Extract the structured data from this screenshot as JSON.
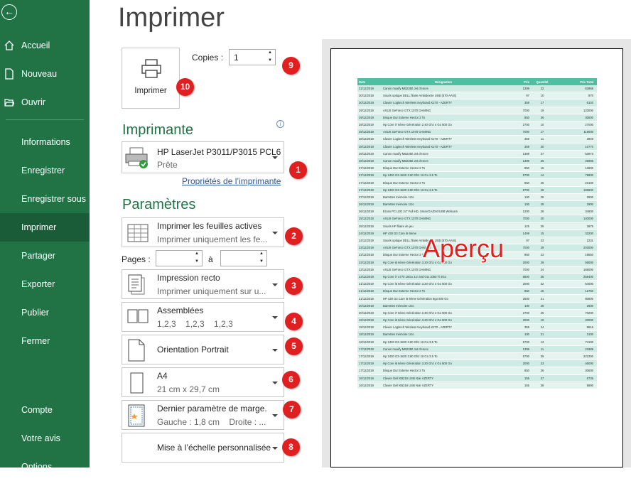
{
  "sidebar": {
    "back_icon": "back-arrow-icon",
    "items": [
      {
        "label": "Accueil",
        "icon": "home-icon"
      },
      {
        "label": "Nouveau",
        "icon": "new-document-icon"
      },
      {
        "label": "Ouvrir",
        "icon": "open-folder-icon"
      },
      {
        "label": "Informations"
      },
      {
        "label": "Enregistrer"
      },
      {
        "label": "Enregistrer sous"
      },
      {
        "label": "Imprimer",
        "selected": true
      },
      {
        "label": "Partager"
      },
      {
        "label": "Exporter"
      },
      {
        "label": "Publier"
      },
      {
        "label": "Fermer"
      },
      {
        "label": "Compte"
      },
      {
        "label": "Votre avis"
      },
      {
        "label": "Options"
      }
    ],
    "bg_color": "#217346",
    "selected_color": "#1a5c38"
  },
  "page_title": "Imprimer",
  "print_button": {
    "label": "Imprimer",
    "badge": "10"
  },
  "copies": {
    "label": "Copies :",
    "value": "1",
    "badge": "9"
  },
  "printer": {
    "section_title": "Imprimante",
    "info_icon": "info-icon",
    "name": "HP LaserJet P3011/P3015 PCL6",
    "status": "Prête",
    "badge": "1",
    "properties_link": "Propriétés de l’imprimante"
  },
  "settings": {
    "section_title": "Paramètres",
    "items": [
      {
        "line1": "Imprimer les feuilles actives",
        "line2": "Imprimer uniquement les fe...",
        "badge": "2",
        "icon": "sheets-grid-icon"
      },
      {
        "line1": "Impression recto",
        "line2": "Imprimer uniquement sur u...",
        "badge": "3",
        "icon": "one-sided-icon"
      },
      {
        "line1": "Assemblées",
        "line2": "1,2,3    1,2,3    1,2,3",
        "badge": "4",
        "icon": "collated-icon"
      },
      {
        "line1": "Orientation Portrait",
        "line2": "",
        "badge": "5",
        "icon": "portrait-icon"
      },
      {
        "line1": "A4",
        "line2": "21 cm x 29,7 cm",
        "badge": "6",
        "icon": "paper-size-icon"
      },
      {
        "line1": "Dernier paramètre de marge...",
        "line2": "Gauche : 1,8 cm    Droite : ...",
        "badge": "7",
        "icon": "margins-icon"
      },
      {
        "line1": "Mise à l’échelle personnalisée",
        "line2": "",
        "badge": "8",
        "icon": ""
      }
    ],
    "pages_label": "Pages :",
    "pages_to": "à",
    "pages_from_value": "",
    "pages_to_value": ""
  },
  "preview": {
    "overlay_label": "Aperçu",
    "table_header": [
      "Date",
      "Désignation",
      "Prix",
      "Quantité",
      "Prix Total"
    ],
    "rows": [
      [
        "31/12/2019",
        "Canon maxify MB2350 Jet d'encre",
        "1399",
        "22",
        "63968"
      ],
      [
        "30/12/2019",
        "Souris optique DELL filaire Ambidextre USB (570-AAIS)",
        "97",
        "10",
        "970"
      ],
      [
        "30/12/2019",
        "Clavier Logitech Wireless Keyboard K270 - AZERTY",
        "359",
        "17",
        "6103"
      ],
      [
        "29/12/2019",
        "ASUS GeForce GTX 1070 GAMING",
        "7000",
        "19",
        "133000"
      ],
      [
        "29/12/2019",
        "Disque Dur Externe Hector 2 To",
        "850",
        "36",
        "30600"
      ],
      [
        "28/12/2019",
        "Hp Core i7 6ème Génération 2.40 Ghz 4 Go 500 Go",
        "2700",
        "10",
        "27000"
      ],
      [
        "28/12/2019",
        "ASUS GeForce GTX 1070 GAMING",
        "7000",
        "17",
        "119000"
      ],
      [
        "28/12/2019",
        "Clavier Logitech Wireless Keyboard K270 - AZERTY",
        "359",
        "11",
        "3949"
      ],
      [
        "28/12/2019",
        "Clavier Logitech Wireless Keyboard K270 - AZERTY",
        "359",
        "30",
        "10770"
      ],
      [
        "28/12/2019",
        "Canon maxify MB2350 Jet d'encre",
        "1399",
        "37",
        "53973"
      ],
      [
        "28/12/2019",
        "Canon maxify MB2350 Jet d'encre",
        "1399",
        "35",
        "25985"
      ],
      [
        "27/12/2019",
        "Disque Dur Externe Hector 2 To",
        "850",
        "16",
        "13600"
      ],
      [
        "27/12/2019",
        "Hp 2430 G3-1820 3.80 Ghz 16 Go 3.5 To",
        "5700",
        "14",
        "79800"
      ],
      [
        "27/12/2019",
        "Disque Dur Externe Hector 2 To",
        "850",
        "26",
        "23100"
      ],
      [
        "27/12/2019",
        "Hp 2430 G3-1820 3.80 Ghz 16 Go 3.5 To",
        "5700",
        "28",
        "159600"
      ],
      [
        "27/12/2019",
        "Barrettes mémoire 1Go",
        "100",
        "25",
        "2500"
      ],
      [
        "26/12/2019",
        "Barrettes mémoire 1Go",
        "100",
        "29",
        "2900"
      ],
      [
        "26/12/2019",
        "Écran PC LED 24\" Full HD, SmaVGA/DVI/USB Webcam",
        "1200",
        "29",
        "34800"
      ],
      [
        "25/12/2019",
        "ASUS GeForce GTX 1070 GAMING",
        "7000",
        "20",
        "140000"
      ],
      [
        "25/12/2019",
        "Souris HP filaire de jeu",
        "125",
        "35",
        "3875"
      ],
      [
        "24/12/2019",
        "HP 430 G3 Core i5 6ème",
        "1499",
        "15",
        "32200"
      ],
      [
        "24/12/2019",
        "Souris optique DELL filaire Ambidextre USB (570-AAIS)",
        "97",
        "23",
        "2231"
      ],
      [
        "23/12/2019",
        "ASUS GeForce GTX 1070 GAMING",
        "7000",
        "29",
        "203000"
      ],
      [
        "23/12/2019",
        "Disque Dur Externe Hector 2 To",
        "850",
        "23",
        "19550"
      ],
      [
        "23/12/2019",
        "Hp Core i5 6ème Génération 3.20 Ghz 4 Go 500 Go",
        "2000",
        "29",
        "58000"
      ],
      [
        "23/12/2019",
        "ASUS GeForce GTX 1070 GAMING",
        "7000",
        "24",
        "168000"
      ],
      [
        "23/12/2019",
        "Hp Core i7 4770 16Go 3.2 Ssd Gtx 1050 Ti 4Go",
        "6800",
        "38",
        "258400"
      ],
      [
        "21/12/2019",
        "Hp Core i5 6ème Génération 3.20 Ghz 4 Go 500 Go",
        "2000",
        "32",
        "64000"
      ],
      [
        "21/12/2019",
        "Disque Dur Externe Hector 2 To",
        "850",
        "15",
        "12750"
      ],
      [
        "21/12/2019",
        "HP 430 G3 Core i5 6ème Génération 8go 500 Go",
        "2600",
        "31",
        "80600"
      ],
      [
        "20/12/2019",
        "Barrettes mémoire 1Go",
        "100",
        "26",
        "2600"
      ],
      [
        "20/12/2019",
        "Hp Core i7 6ème Génération 2.40 Ghz 4 Go 500 Go",
        "2700",
        "26",
        "70200"
      ],
      [
        "19/12/2019",
        "Hp Core i5 6ème Génération 3.20 Ghz 4 Go 500 Go",
        "2000",
        "10",
        "20000"
      ],
      [
        "19/12/2019",
        "Clavier Logitech Wireless Keyboard K270 - AZERTY",
        "359",
        "24",
        "8616"
      ],
      [
        "18/12/2019",
        "Barrettes mémoire 1Go",
        "100",
        "31",
        "3100"
      ],
      [
        "18/12/2019",
        "Hp 2430 G3-1820 3.80 Ghz 16 Go 3.5 To",
        "5700",
        "13",
        "74100"
      ],
      [
        "17/12/2019",
        "Canon maxify MB2350 Jet d'encre",
        "1399",
        "11",
        "21989"
      ],
      [
        "17/12/2019",
        "Hp 2430 G3-1820 3.80 Ghz 16 Go 3.5 To",
        "5700",
        "39",
        "222300"
      ],
      [
        "17/12/2019",
        "Hp Core i5 6ème Génération 3.20 Ghz 4 Go 500 Go",
        "2000",
        "23",
        "46000"
      ],
      [
        "17/12/2019",
        "Disque Dur Externe Hector 2 To",
        "850",
        "36",
        "30600"
      ],
      [
        "16/12/2019",
        "Clavier Dell KB216 USB Noir AZERTY",
        "155",
        "37",
        "5735"
      ],
      [
        "16/12/2019",
        "Clavier Dell KB216 USB Noir AZERTY",
        "155",
        "38",
        "5890"
      ]
    ]
  }
}
